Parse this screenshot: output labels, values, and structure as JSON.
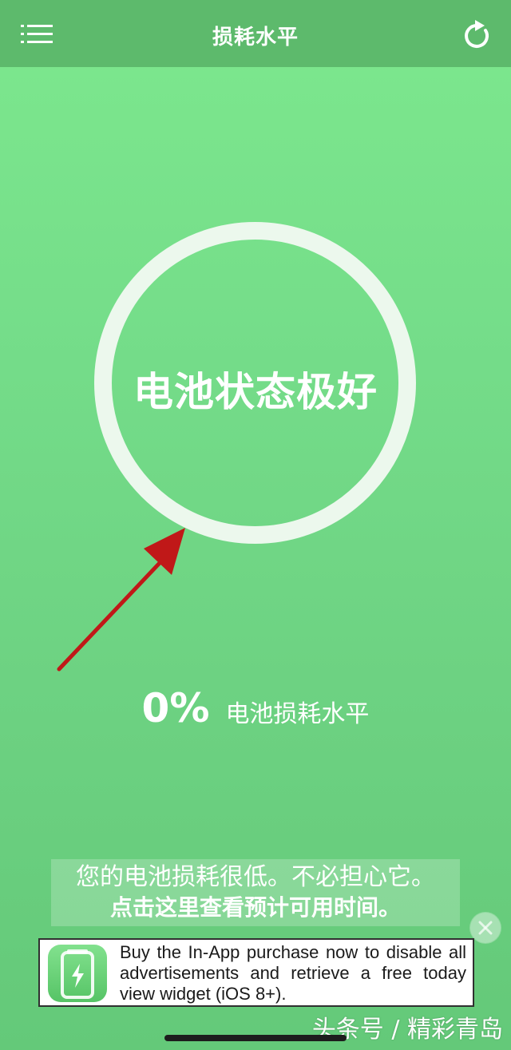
{
  "header": {
    "title": "损耗水平",
    "menu_icon": "menu-list-icon",
    "refresh_icon": "refresh-icon"
  },
  "status": {
    "text": "电池状态极好"
  },
  "wear": {
    "value": "0%",
    "label": "电池损耗水平"
  },
  "message": {
    "line1": "您的电池损耗很低。不必担心它。",
    "line2": "点击这里查看预计可用时间。"
  },
  "ad": {
    "text": "Buy the In-App purchase now to disable all advertisements and retrieve a free today view widget (iOS 8+).",
    "icon": "battery-charging-icon"
  },
  "watermark": {
    "text": "头条号 / 精彩青岛"
  },
  "colors": {
    "background": "#74dc89",
    "header": "#5dba6c",
    "ring": "#ecf8ed",
    "arrow": "#c01818"
  }
}
